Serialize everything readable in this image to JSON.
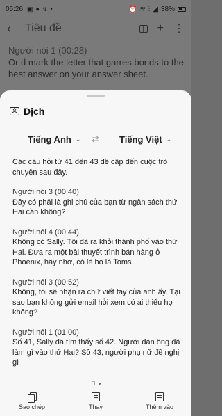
{
  "status_bar": {
    "time": "05:26",
    "left_icons": [
      "image-icon",
      "mic-icon",
      "signal-icon",
      "dot"
    ],
    "right_icons": [
      "alarm-icon",
      "wifi-icon",
      "volte-icon",
      "signal-icon"
    ],
    "battery": "38%"
  },
  "app_bar": {
    "title": "Tiêu đề"
  },
  "transcript": {
    "speaker": "Người nói 1  (00:28)",
    "text": "Or d mark the letter that garres bonds to the best answer on your answer sheet."
  },
  "sheet": {
    "title": "Dịch",
    "source_lang": "Tiếng Anh",
    "target_lang": "Tiếng Việt",
    "swap_symbol": "⇄",
    "blocks": [
      {
        "speaker": "",
        "text": "Các câu hỏi từ 41 đến 43 đề cập đến cuộc trò chuyện sau đây."
      },
      {
        "speaker": "Người nói 3 (00:40)",
        "text": "Đây có phải là ghi chú của bạn từ ngân sách thứ Hai cần không?"
      },
      {
        "speaker": "Người nói 4 (00:44)",
        "text": "Không có Sally. Tôi đã ra khỏi thành phố vào thứ Hai. Đưa ra một bài thuyết trình bán hàng ở Phoenix, hãy nhớ, có lẽ họ là Toms."
      },
      {
        "speaker": "Người nói 3 (00:52)",
        "text": "Không, tôi sẽ nhận ra chữ viết tay của anh ấy. Tại sao bạn không gửi email hỏi xem có ai thiếu họ không?"
      },
      {
        "speaker": "Người nói 1 (01:00)",
        "text": "Số 41, Sally đã tìm thấy số 42. Người đàn ông đã làm gì vào thứ Hai? Số 43, người phụ nữ đề nghị gì"
      }
    ],
    "actions": {
      "copy": "Sao chép",
      "replace": "Thay",
      "insert": "Thêm vào"
    }
  }
}
